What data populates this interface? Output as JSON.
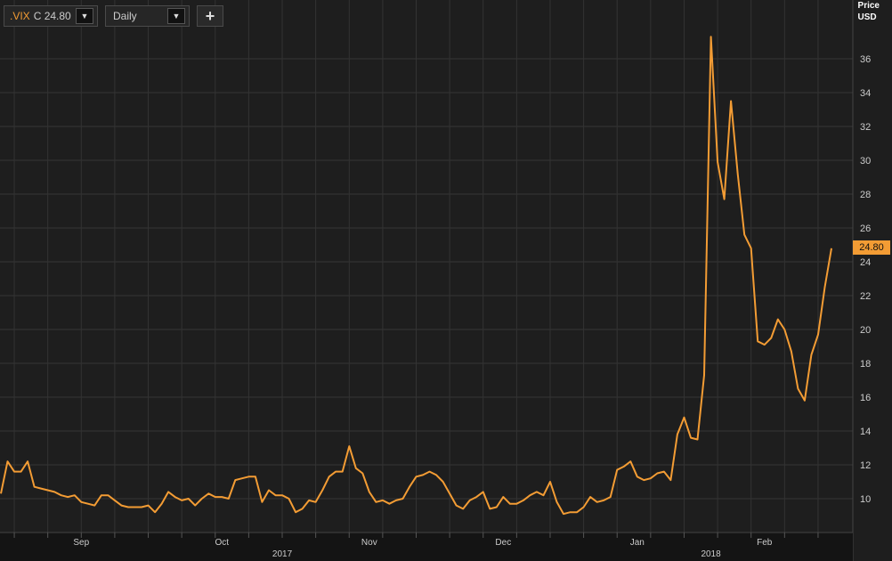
{
  "toolbar": {
    "symbol": ".VIX",
    "quote_prefix": "C",
    "quote_value": "24.80",
    "period": "Daily",
    "dropdown_glyph": "▼",
    "add_glyph": "+"
  },
  "colors": {
    "background": "#1e1e1e",
    "grid": "#353535",
    "line": "#f39c34",
    "text": "#cccccc"
  },
  "chart_data": {
    "type": "line",
    "ylabel": "Price",
    "yunit": "USD",
    "ylim": [
      8,
      38
    ],
    "yticks": [
      10,
      12,
      14,
      16,
      18,
      20,
      22,
      24,
      26,
      28,
      30,
      32,
      34,
      36
    ],
    "grid": true,
    "last_value_label": "24.80",
    "x_month_labels": [
      {
        "label": "Sep",
        "index": 12
      },
      {
        "label": "Oct",
        "index": 33
      },
      {
        "label": "Nov",
        "index": 55
      },
      {
        "label": "Dec",
        "index": 75
      },
      {
        "label": "Jan",
        "index": 95
      },
      {
        "label": "Feb",
        "index": 114
      }
    ],
    "x_year_labels": [
      {
        "label": "2017",
        "index": 42
      },
      {
        "label": "2018",
        "index": 106
      }
    ],
    "series": [
      {
        "values": [
          10.3,
          12.2,
          11.6,
          11.6,
          12.2,
          10.7,
          10.6,
          10.5,
          10.4,
          10.2,
          10.1,
          10.2,
          9.8,
          9.7,
          9.6,
          10.2,
          10.2,
          9.9,
          9.6,
          9.5,
          9.5,
          9.5,
          9.6,
          9.2,
          9.7,
          10.4,
          10.1,
          9.9,
          10.0,
          9.6,
          10.0,
          10.3,
          10.1,
          10.1,
          10.0,
          11.1,
          11.2,
          11.3,
          11.3,
          9.8,
          10.5,
          10.2,
          10.2,
          10.0,
          9.2,
          9.4,
          9.9,
          9.8,
          10.5,
          11.3,
          11.6,
          11.6,
          13.1,
          11.8,
          11.5,
          10.4,
          9.8,
          9.9,
          9.7,
          9.9,
          10.0,
          10.7,
          11.3,
          11.4,
          11.6,
          11.4,
          11.0,
          10.3,
          9.6,
          9.4,
          9.9,
          10.1,
          10.4,
          9.4,
          9.5,
          10.1,
          9.7,
          9.7,
          9.9,
          10.2,
          10.4,
          10.2,
          11.0,
          9.8,
          9.1,
          9.2,
          9.2,
          9.5,
          10.1,
          9.8,
          9.9,
          10.1,
          11.7,
          11.9,
          12.2,
          11.3,
          11.1,
          11.2,
          11.5,
          11.6,
          11.1,
          13.8,
          14.8,
          13.6,
          13.5,
          17.3,
          37.3,
          29.9,
          27.7,
          33.5,
          29.2,
          25.6,
          24.8,
          19.3,
          19.1,
          19.5,
          20.6,
          20.0,
          18.7,
          16.5,
          15.8,
          18.5,
          19.7,
          22.5,
          24.8
        ]
      }
    ]
  }
}
